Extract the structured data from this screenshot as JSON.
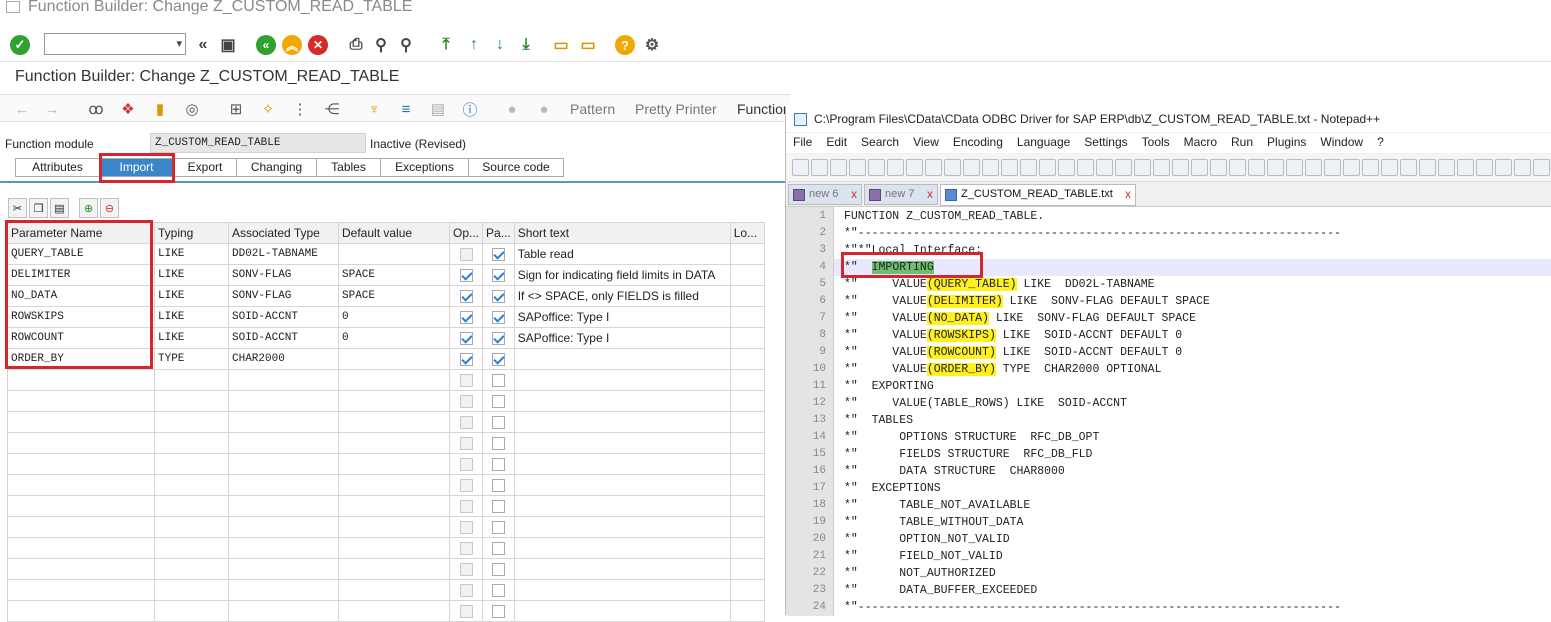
{
  "sap": {
    "window_title": "Function Builder: Change Z_CUSTOM_READ_TABLE",
    "subtitle": "Function Builder: Change Z_CUSTOM_READ_TABLE",
    "command_field": "",
    "app_toolbar": {
      "pattern": "Pattern",
      "pretty_printer": "Pretty Printer",
      "function_module_docu": "Function Module Documentation",
      "truncated": "Function"
    },
    "function_module_label": "Function module",
    "function_module_value": "Z_CUSTOM_READ_TABLE",
    "status": "Inactive (Revised)",
    "tabs": [
      {
        "label": "Attributes"
      },
      {
        "label": "Import"
      },
      {
        "label": "Export"
      },
      {
        "label": "Changing"
      },
      {
        "label": "Tables"
      },
      {
        "label": "Exceptions"
      },
      {
        "label": "Source code"
      }
    ],
    "active_tab": "Import",
    "table": {
      "headers": [
        "Parameter Name",
        "Typing",
        "Associated Type",
        "Default value",
        "Op...",
        "Pa...",
        "Short text",
        "Lo..."
      ],
      "rows": [
        {
          "name": "QUERY_TABLE",
          "typing": "LIKE",
          "assoc": "DD02L-TABNAME",
          "default": "",
          "opt": false,
          "pass": true,
          "short": "Table read"
        },
        {
          "name": "DELIMITER",
          "typing": "LIKE",
          "assoc": "SONV-FLAG",
          "default": "SPACE",
          "opt": true,
          "pass": true,
          "short": "Sign for indicating field limits in DATA"
        },
        {
          "name": "NO_DATA",
          "typing": "LIKE",
          "assoc": "SONV-FLAG",
          "default": "SPACE",
          "opt": true,
          "pass": true,
          "short": "If <> SPACE, only FIELDS is filled"
        },
        {
          "name": "ROWSKIPS",
          "typing": "LIKE",
          "assoc": "SOID-ACCNT",
          "default": "0",
          "opt": true,
          "pass": true,
          "short": "SAPoffice: Type I"
        },
        {
          "name": "ROWCOUNT",
          "typing": "LIKE",
          "assoc": "SOID-ACCNT",
          "default": "0",
          "opt": true,
          "pass": true,
          "short": "SAPoffice: Type I"
        },
        {
          "name": "ORDER_BY",
          "typing": "TYPE",
          "assoc": "CHAR2000",
          "default": "",
          "opt": true,
          "pass": true,
          "short": ""
        }
      ],
      "empty_rows": 12
    }
  },
  "notepad": {
    "title": "C:\\Program Files\\CData\\CData ODBC Driver for SAP ERP\\db\\Z_CUSTOM_READ_TABLE.txt - Notepad++",
    "menu": [
      "File",
      "Edit",
      "Search",
      "View",
      "Encoding",
      "Language",
      "Settings",
      "Tools",
      "Macro",
      "Run",
      "Plugins",
      "Window",
      "?"
    ],
    "tabs": [
      {
        "label": "new 6",
        "close": "x"
      },
      {
        "label": "new 7",
        "close": "x"
      },
      {
        "label": "Z_CUSTOM_READ_TABLE.txt",
        "close": "x"
      }
    ],
    "lines": [
      {
        "n": "1",
        "t": "FUNCTION Z_CUSTOM_READ_TABLE."
      },
      {
        "n": "2",
        "t": "*\"----------------------------------------------------------------------"
      },
      {
        "n": "3",
        "t": "*\"*\"Local Interface:"
      },
      {
        "n": "4",
        "pre": "*\"  ",
        "hl": "IMPORTING",
        "post": ""
      },
      {
        "n": "5",
        "pre": "*\"     VALUE",
        "hl": "(QUERY_TABLE)",
        "post": " LIKE  DD02L-TABNAME"
      },
      {
        "n": "6",
        "pre": "*\"     VALUE",
        "hl": "(DELIMITER)",
        "post": " LIKE  SONV-FLAG DEFAULT SPACE"
      },
      {
        "n": "7",
        "pre": "*\"     VALUE",
        "hl": "(NO_DATA)",
        "post": " LIKE  SONV-FLAG DEFAULT SPACE"
      },
      {
        "n": "8",
        "pre": "*\"     VALUE",
        "hl": "(ROWSKIPS)",
        "post": " LIKE  SOID-ACCNT DEFAULT 0"
      },
      {
        "n": "9",
        "pre": "*\"     VALUE",
        "hl": "(ROWCOUNT)",
        "post": " LIKE  SOID-ACCNT DEFAULT 0"
      },
      {
        "n": "10",
        "pre": "*\"     VALUE",
        "hl": "(ORDER_BY)",
        "post": " TYPE  CHAR2000 OPTIONAL"
      },
      {
        "n": "11",
        "t": "*\"  EXPORTING"
      },
      {
        "n": "12",
        "t": "*\"     VALUE(TABLE_ROWS) LIKE  SOID-ACCNT"
      },
      {
        "n": "13",
        "t": "*\"  TABLES"
      },
      {
        "n": "14",
        "t": "*\"      OPTIONS STRUCTURE  RFC_DB_OPT"
      },
      {
        "n": "15",
        "t": "*\"      FIELDS STRUCTURE  RFC_DB_FLD"
      },
      {
        "n": "16",
        "t": "*\"      DATA STRUCTURE  CHAR8000"
      },
      {
        "n": "17",
        "t": "*\"  EXCEPTIONS"
      },
      {
        "n": "18",
        "t": "*\"      TABLE_NOT_AVAILABLE"
      },
      {
        "n": "19",
        "t": "*\"      TABLE_WITHOUT_DATA"
      },
      {
        "n": "20",
        "t": "*\"      OPTION_NOT_VALID"
      },
      {
        "n": "21",
        "t": "*\"      FIELD_NOT_VALID"
      },
      {
        "n": "22",
        "t": "*\"      NOT_AUTHORIZED"
      },
      {
        "n": "23",
        "t": "*\"      DATA_BUFFER_EXCEEDED"
      },
      {
        "n": "24",
        "t": "*\"----------------------------------------------------------------------"
      }
    ]
  },
  "colors": {
    "sap_tab_active": "#3a86c9",
    "annotation_red": "#d6262d",
    "highlight_yellow": "#fff020",
    "highlight_green": "#6cc070"
  }
}
